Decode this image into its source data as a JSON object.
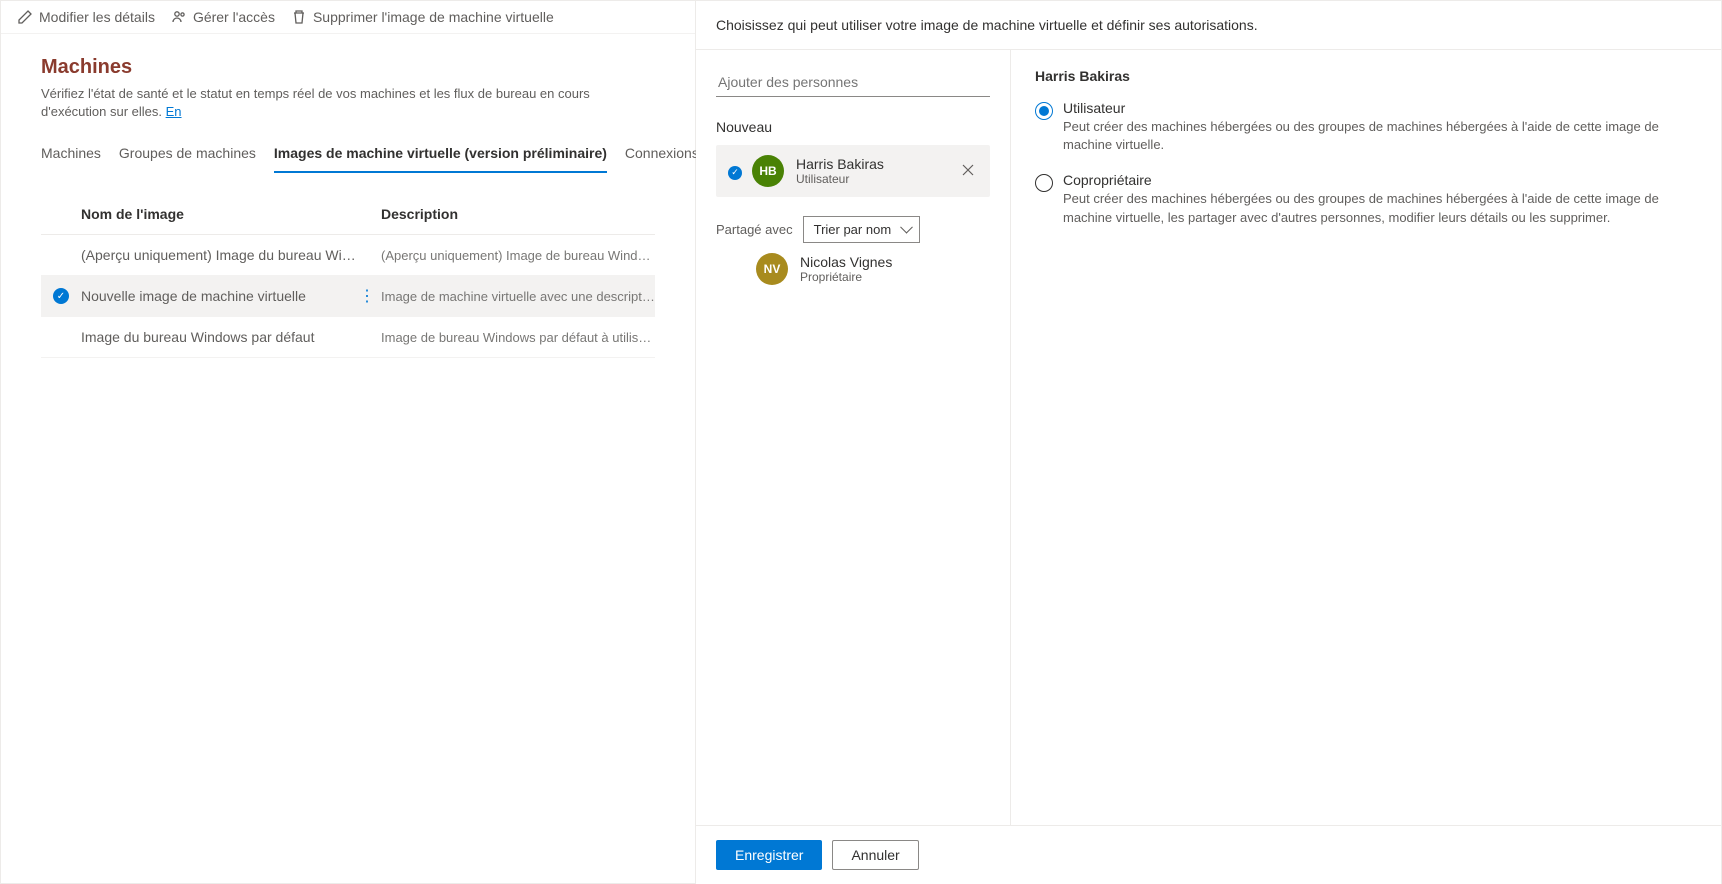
{
  "actions": {
    "edit": "Modifier les détails",
    "manage": "Gérer l'accès",
    "delete": "Supprimer l'image de machine virtuelle"
  },
  "header": {
    "title": "Machines",
    "subtitle": "Vérifiez l'état de santé et le statut en temps réel de vos machines et les flux de bureau en cours d'exécution sur elles.",
    "link": "En"
  },
  "tabs": [
    {
      "label": "Machines"
    },
    {
      "label": "Groupes de machines"
    },
    {
      "label": "Images de machine virtuelle (version préliminaire)"
    },
    {
      "label": "Connexions réseau (version p"
    }
  ],
  "table": {
    "columns": {
      "name": "Nom de l'image",
      "desc": "Description"
    },
    "rows": [
      {
        "name": "(Aperçu uniquement) Image du bureau Win…",
        "desc": "(Aperçu uniquement) Image de bureau Windows par défaut pou",
        "selected": false
      },
      {
        "name": "Nouvelle image de machine virtuelle",
        "desc": "Image de machine virtuelle avec une description",
        "selected": true
      },
      {
        "name": "Image du bureau Windows par défaut",
        "desc": "Image de bureau Windows par défaut à utiliser dans Microsoft D",
        "selected": false
      }
    ]
  },
  "panel": {
    "intro": "Choisissez qui peut utiliser votre image de machine virtuelle et définir ses autorisations.",
    "search_placeholder": "Ajouter des personnes",
    "new_label": "Nouveau",
    "new_person": {
      "initials": "HB",
      "name": "Harris Bakiras",
      "role": "Utilisateur"
    },
    "shared_label": "Partagé avec",
    "sort_label": "Trier par nom",
    "shared_person": {
      "initials": "NV",
      "name": "Nicolas Vignes",
      "role": "Propriétaire"
    },
    "right_title": "Harris Bakiras",
    "roles": [
      {
        "label": "Utilisateur",
        "desc": "Peut créer des machines hébergées ou des groupes de machines hébergées à l'aide de cette image de machine virtuelle.",
        "selected": true
      },
      {
        "label": "Copropriétaire",
        "desc": "Peut créer des machines hébergées ou des groupes de machines hébergées à l'aide de cette image de machine virtuelle, les partager avec d'autres personnes, modifier leurs détails ou les supprimer.",
        "selected": false
      }
    ],
    "save": "Enregistrer",
    "cancel": "Annuler"
  }
}
